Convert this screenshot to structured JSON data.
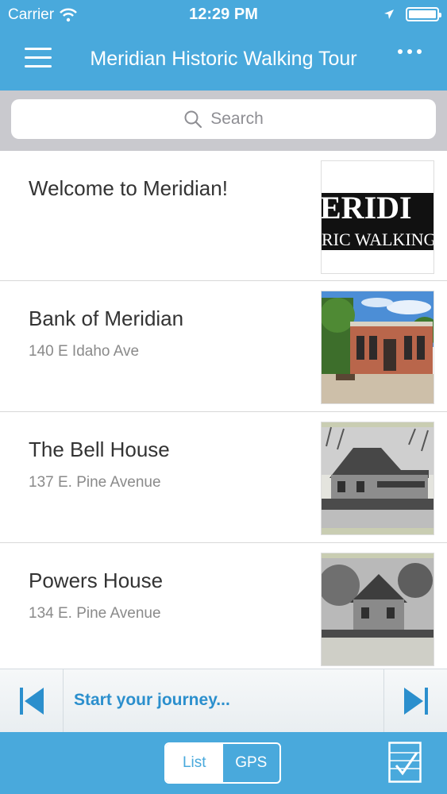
{
  "status_bar": {
    "carrier": "Carrier",
    "time": "12:29 PM",
    "battery_level": 1.0
  },
  "navbar": {
    "title": "Meridian Historic Walking Tour",
    "menu_icon": "hamburger-icon",
    "more_icon": "more-icon"
  },
  "search": {
    "placeholder": "Search"
  },
  "tour_stops": [
    {
      "title": "Welcome to Meridian!",
      "subtitle": "",
      "thumb_text_1": "ERIDI",
      "thumb_text_2": "RIC WALKING"
    },
    {
      "title": "Bank of Meridian",
      "subtitle": "140 E Idaho Ave"
    },
    {
      "title": "The Bell House",
      "subtitle": "137 E. Pine Avenue"
    },
    {
      "title": "Powers House",
      "subtitle": "134 E. Pine Avenue"
    }
  ],
  "player": {
    "text": "Start your journey..."
  },
  "tabbar": {
    "list_label": "List",
    "gps_label": "GPS",
    "selected": "List"
  },
  "colors": {
    "accent": "#49a9dc",
    "player_text": "#2b8fcd"
  }
}
